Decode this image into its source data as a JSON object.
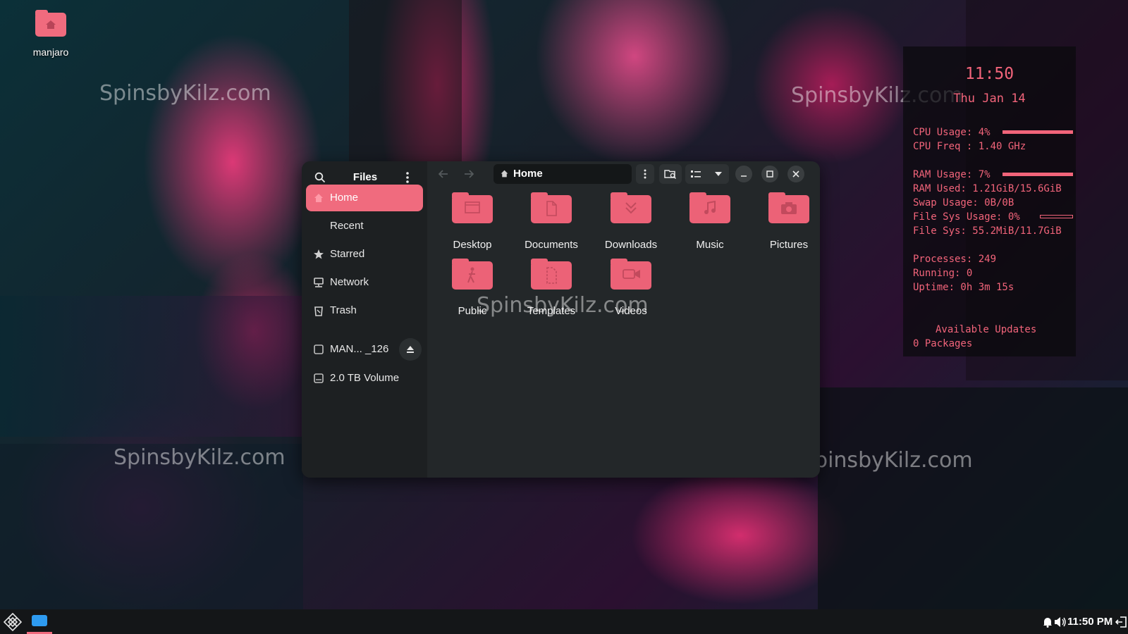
{
  "desktop": {
    "icon_label": "manjaro",
    "watermarks": [
      "SpinsbyKilz.com",
      "SpinsbyKilz.com",
      "SpinsbyKilz.com",
      "SpinsbyKilz.com",
      "SpinsbyKilz.com"
    ]
  },
  "conky": {
    "time": "11:50",
    "date": "Thu Jan 14",
    "cpu_usage": "CPU Usage: 4%",
    "cpu_freq": "CPU Freq : 1.40 GHz",
    "ram_usage": "RAM Usage: 7%",
    "ram_used": "RAM Used: 1.21GiB/15.6GiB",
    "swap_usage": "Swap Usage: 0B/0B",
    "fs_usage": "File Sys Usage:  0%",
    "fs": "File Sys: 55.2MiB/11.7GiB",
    "processes": "Processes: 249",
    "running": "Running: 0",
    "uptime": "Uptime: 0h 3m 15s",
    "updates_title": "Available Updates",
    "updates_count": "0 Packages",
    "cpu_level": 0.04,
    "ram_level": 0.07,
    "fs_level": 0.0
  },
  "files": {
    "title": "Files",
    "path": "Home",
    "sidebar": [
      {
        "label": "Home",
        "icon": "home-icon",
        "active": true
      },
      {
        "label": "Recent",
        "icon": "clock-icon"
      },
      {
        "label": "Starred",
        "icon": "star-icon"
      },
      {
        "label": "Network",
        "icon": "network-icon"
      },
      {
        "label": "Trash",
        "icon": "trash-icon"
      }
    ],
    "devices": [
      {
        "label": "MAN...  _126",
        "icon": "drive-icon"
      },
      {
        "label": "2.0 TB Volume",
        "icon": "drive-icon"
      }
    ],
    "items": [
      {
        "label": "Desktop",
        "icon": "desktop-folder-icon"
      },
      {
        "label": "Documents",
        "icon": "documents-folder-icon"
      },
      {
        "label": "Downloads",
        "icon": "downloads-folder-icon"
      },
      {
        "label": "Music",
        "icon": "music-folder-icon"
      },
      {
        "label": "Pictures",
        "icon": "pictures-folder-icon"
      },
      {
        "label": "Public",
        "icon": "public-folder-icon"
      },
      {
        "label": "Templates",
        "icon": "templates-folder-icon"
      },
      {
        "label": "Videos",
        "icon": "videos-folder-icon"
      }
    ]
  },
  "taskbar": {
    "clock": "11:50 PM"
  },
  "colors": {
    "accent": "#f06b7e",
    "conky_text": "#f2647a",
    "window_bg": "#232729",
    "sidebar_bg": "#1d2022"
  }
}
